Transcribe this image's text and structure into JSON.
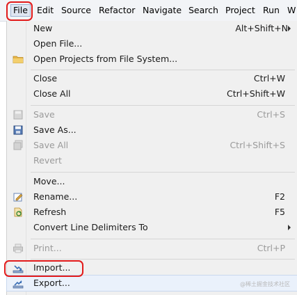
{
  "menubar": {
    "items": [
      "File",
      "Edit",
      "Source",
      "Refactor",
      "Navigate",
      "Search",
      "Project",
      "Run",
      "W"
    ]
  },
  "file_menu": {
    "new": {
      "label": "New",
      "shortcut": "Alt+Shift+N"
    },
    "open_file": {
      "label": "Open File..."
    },
    "open_projects": {
      "label": "Open Projects from File System..."
    },
    "close": {
      "label": "Close",
      "shortcut": "Ctrl+W"
    },
    "close_all": {
      "label": "Close All",
      "shortcut": "Ctrl+Shift+W"
    },
    "save": {
      "label": "Save",
      "shortcut": "Ctrl+S"
    },
    "save_as": {
      "label": "Save As..."
    },
    "save_all": {
      "label": "Save All",
      "shortcut": "Ctrl+Shift+S"
    },
    "revert": {
      "label": "Revert"
    },
    "move": {
      "label": "Move..."
    },
    "rename": {
      "label": "Rename...",
      "shortcut": "F2"
    },
    "refresh": {
      "label": "Refresh",
      "shortcut": "F5"
    },
    "convert": {
      "label": "Convert Line Delimiters To"
    },
    "print": {
      "label": "Print...",
      "shortcut": "Ctrl+P"
    },
    "import": {
      "label": "Import..."
    },
    "export": {
      "label": "Export..."
    }
  },
  "watermark": "@稀土掘金技术社区",
  "colors": {
    "highlight_box": "#e21a1a",
    "menu_bg": "#f0f0f0"
  }
}
